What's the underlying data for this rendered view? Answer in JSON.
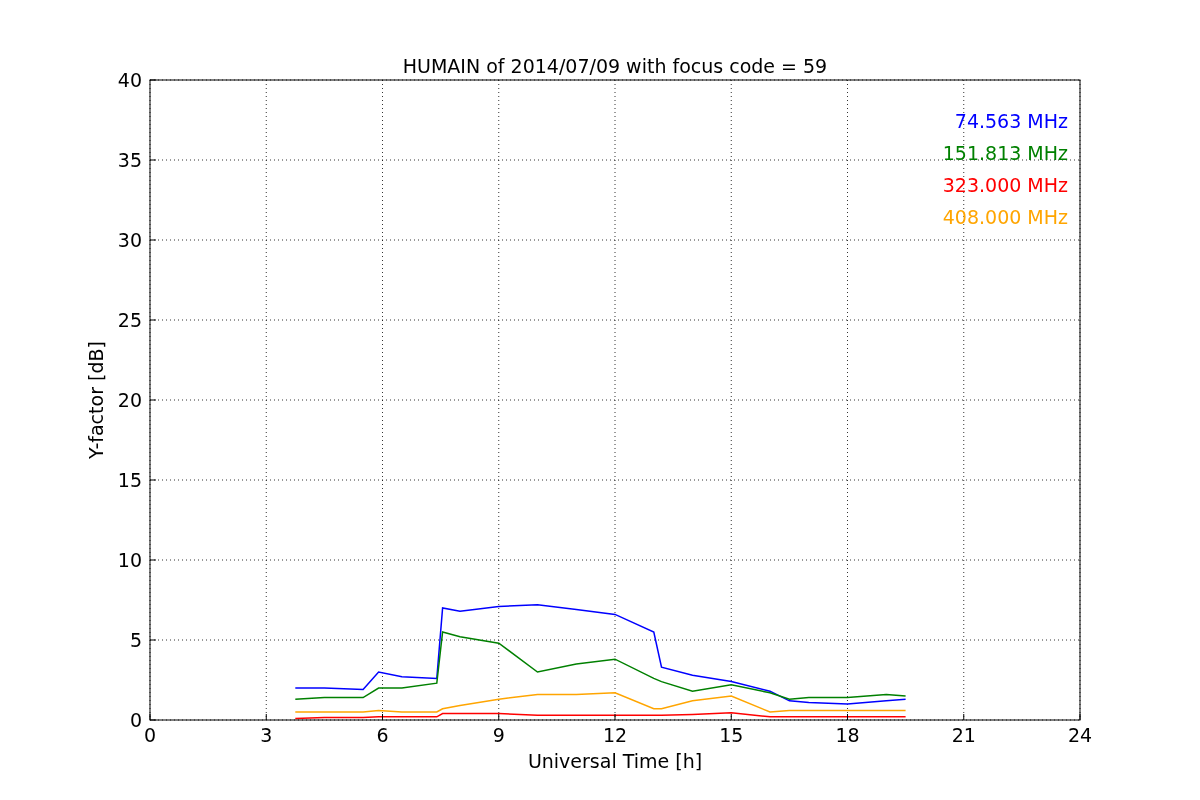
{
  "chart_data": {
    "type": "line",
    "title": "HUMAIN of 2014/07/09 with focus code = 59",
    "xlabel": "Universal Time [h]",
    "ylabel": "Y-factor [dB]",
    "x": [
      3.75,
      4.5,
      5.5,
      5.9,
      6.5,
      7.4,
      7.55,
      8,
      9,
      10,
      11,
      12,
      13,
      13.2,
      14,
      15,
      16,
      16.5,
      17,
      18,
      19,
      19.5
    ],
    "series": [
      {
        "name": "74.563 MHz",
        "color": "#0000ff",
        "values": [
          2.0,
          2.0,
          1.9,
          3.0,
          2.7,
          2.6,
          7.0,
          6.8,
          7.1,
          7.2,
          6.9,
          6.6,
          5.5,
          3.3,
          2.8,
          2.4,
          1.8,
          1.2,
          1.1,
          1.0,
          1.2,
          1.3
        ]
      },
      {
        "name": "151.813 MHz",
        "color": "#008000",
        "values": [
          1.3,
          1.4,
          1.4,
          2.0,
          2.0,
          2.3,
          5.5,
          5.2,
          4.8,
          3.0,
          3.5,
          3.8,
          2.6,
          2.4,
          1.8,
          2.2,
          1.7,
          1.3,
          1.4,
          1.4,
          1.6,
          1.5
        ]
      },
      {
        "name": "323.000 MHz",
        "color": "#ff0000",
        "values": [
          0.1,
          0.15,
          0.15,
          0.2,
          0.2,
          0.2,
          0.4,
          0.4,
          0.4,
          0.3,
          0.3,
          0.3,
          0.3,
          0.3,
          0.35,
          0.45,
          0.2,
          0.2,
          0.2,
          0.2,
          0.2,
          0.2
        ]
      },
      {
        "name": "408.000 MHz",
        "color": "#ffa500",
        "values": [
          0.5,
          0.5,
          0.5,
          0.6,
          0.5,
          0.5,
          0.7,
          0.9,
          1.3,
          1.6,
          1.6,
          1.7,
          0.7,
          0.7,
          1.2,
          1.5,
          0.5,
          0.6,
          0.6,
          0.6,
          0.6,
          0.6
        ]
      }
    ],
    "grid": true,
    "xlim": [
      0,
      24
    ],
    "ylim": [
      0,
      40
    ],
    "xticks": [
      0,
      3,
      6,
      9,
      12,
      15,
      18,
      21,
      24
    ],
    "yticks": [
      0,
      5,
      10,
      15,
      20,
      25,
      30,
      35,
      40
    ]
  }
}
